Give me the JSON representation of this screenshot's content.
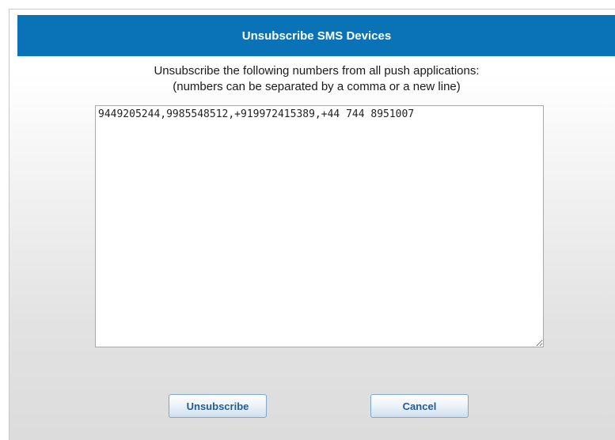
{
  "dialog": {
    "title": "Unsubscribe SMS Devices",
    "instruction_line1": "Unsubscribe the following numbers from all push applications:",
    "instruction_line2": "(numbers can be separated by a comma or a new line)",
    "numbers_value": "9449205244,9985548512,+919972415389,+44 744 8951007",
    "unsubscribe_label": "Unsubscribe",
    "cancel_label": "Cancel"
  },
  "colors": {
    "header_bg": "#0a72b7",
    "button_text": "#1c5f97"
  }
}
